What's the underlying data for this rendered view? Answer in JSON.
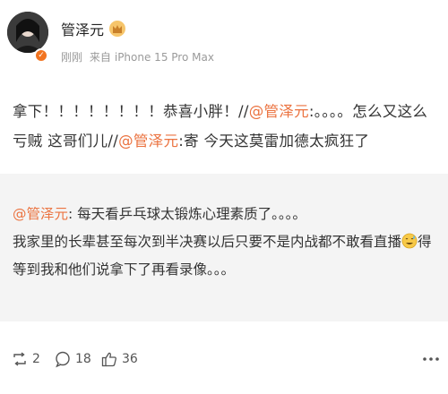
{
  "post": {
    "username": "管泽元",
    "meta": {
      "time": "刚刚",
      "source_prefix": "来自",
      "device": "iPhone 15 Pro Max"
    },
    "text": {
      "part1": "拿下！！！！！！！！恭喜小胖！//",
      "mention1": "@管泽元",
      "part2": ":。。。。怎么又这么亏贼 这哥们儿//",
      "mention2": "@管泽元",
      "part3": ":寄 今天这莫雷加德太疯狂了"
    }
  },
  "repost": {
    "mention": "@管泽元",
    "line1_rest": ": 每天看乒乓球太锻炼心理素质了。。。。",
    "line2a": "我家里的长辈甚至每次到半决赛以后只要不是内战都不敢看直播",
    "emoji": "sweat-smile-emoji",
    "line2b": "得等到我和他们说拿下了再看录像。。。"
  },
  "actions": {
    "repost_count": "2",
    "comment_count": "18",
    "like_count": "36"
  },
  "colors": {
    "mention": "#eb7340",
    "repost_bg": "#f4f4f4",
    "verified_badge": "#f27420",
    "meta_gray": "#9a9a9a"
  },
  "icons": [
    "crown-icon",
    "verified-icon",
    "repost-icon",
    "comment-icon",
    "like-icon",
    "more-icon"
  ]
}
